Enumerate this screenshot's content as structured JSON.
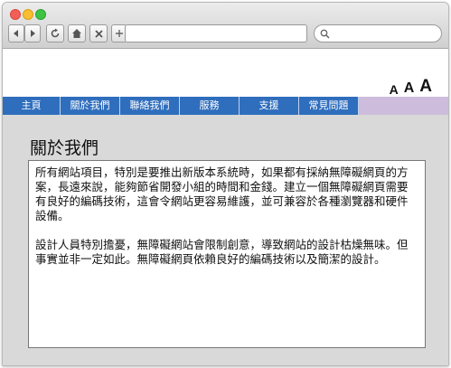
{
  "toolbar": {
    "search_placeholder": ""
  },
  "font_size_controls": {
    "small": "A",
    "medium": "A",
    "large": "A"
  },
  "nav": {
    "items": [
      {
        "label": "主頁"
      },
      {
        "label": "關於我們"
      },
      {
        "label": "聯絡我們"
      },
      {
        "label": "服務"
      },
      {
        "label": "支援"
      },
      {
        "label": "常見問題"
      }
    ]
  },
  "page": {
    "title": "關於我們",
    "paragraphs": [
      "所有網站項目，特別是要推出新版本系統時，如果都有採納無障礙網頁的方案，長遠來說，能夠節省開發小組的時間和金錢。建立一個無障礙網頁需要有良好的編碼技術，這會令網站更容易維護，並可兼容於各種瀏覽器和硬件設備。",
      "設計人員特別擔憂，無障礙網站會限制創意，導致網站的設計枯燥無味。但事實並非一定如此。無障礙網頁依賴良好的編碼技術以及簡潔的設計。"
    ]
  },
  "colors": {
    "nav_background": "#2f6ebd",
    "nav_filler": "#cdbcdb",
    "content_background": "#d9d9d9"
  }
}
